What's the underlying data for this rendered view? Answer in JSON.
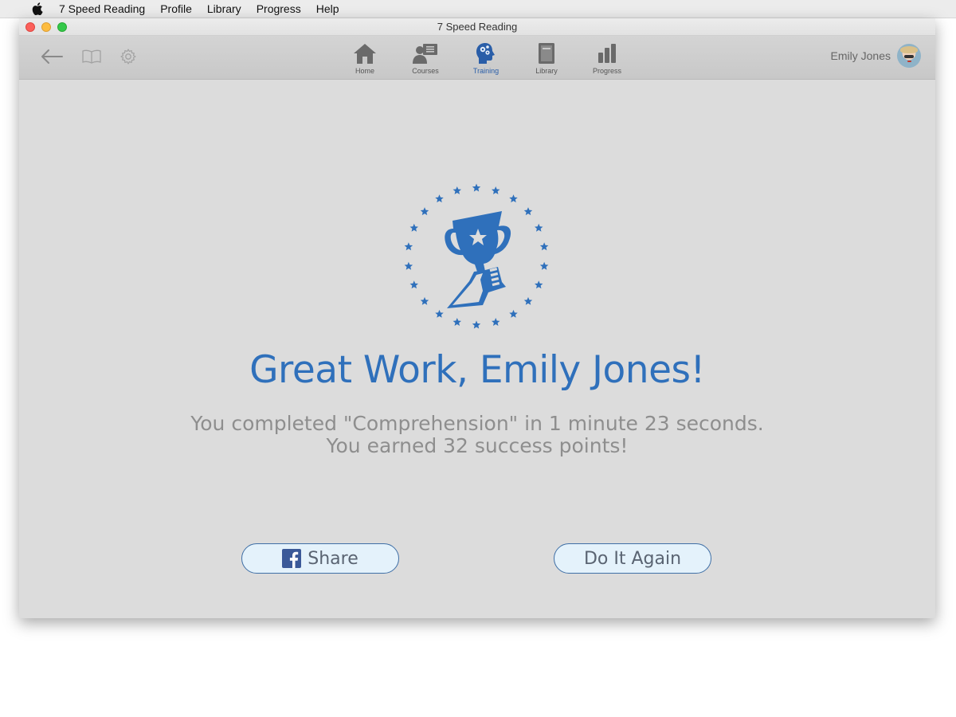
{
  "menubar": {
    "app_name": "7 Speed Reading",
    "items": [
      "Profile",
      "Library",
      "Progress",
      "Help"
    ]
  },
  "window": {
    "title": "7 Speed Reading"
  },
  "toolbar": {
    "nav": [
      {
        "label": "Home",
        "icon": "home-icon"
      },
      {
        "label": "Courses",
        "icon": "courses-icon"
      },
      {
        "label": "Training",
        "icon": "training-icon",
        "active": true
      },
      {
        "label": "Library",
        "icon": "library-icon"
      },
      {
        "label": "Progress",
        "icon": "progress-icon"
      }
    ],
    "user_name": "Emily Jones"
  },
  "result": {
    "headline": "Great Work, Emily Jones!",
    "line1": "You completed \"Comprehension\" in 1 minute 23 seconds.",
    "line2": "You earned 32 success points!",
    "share_label": "Share",
    "again_label": "Do It Again"
  },
  "colors": {
    "accent": "#2f70bb",
    "button_bg": "#e4f2fb",
    "facebook": "#3b5998"
  }
}
